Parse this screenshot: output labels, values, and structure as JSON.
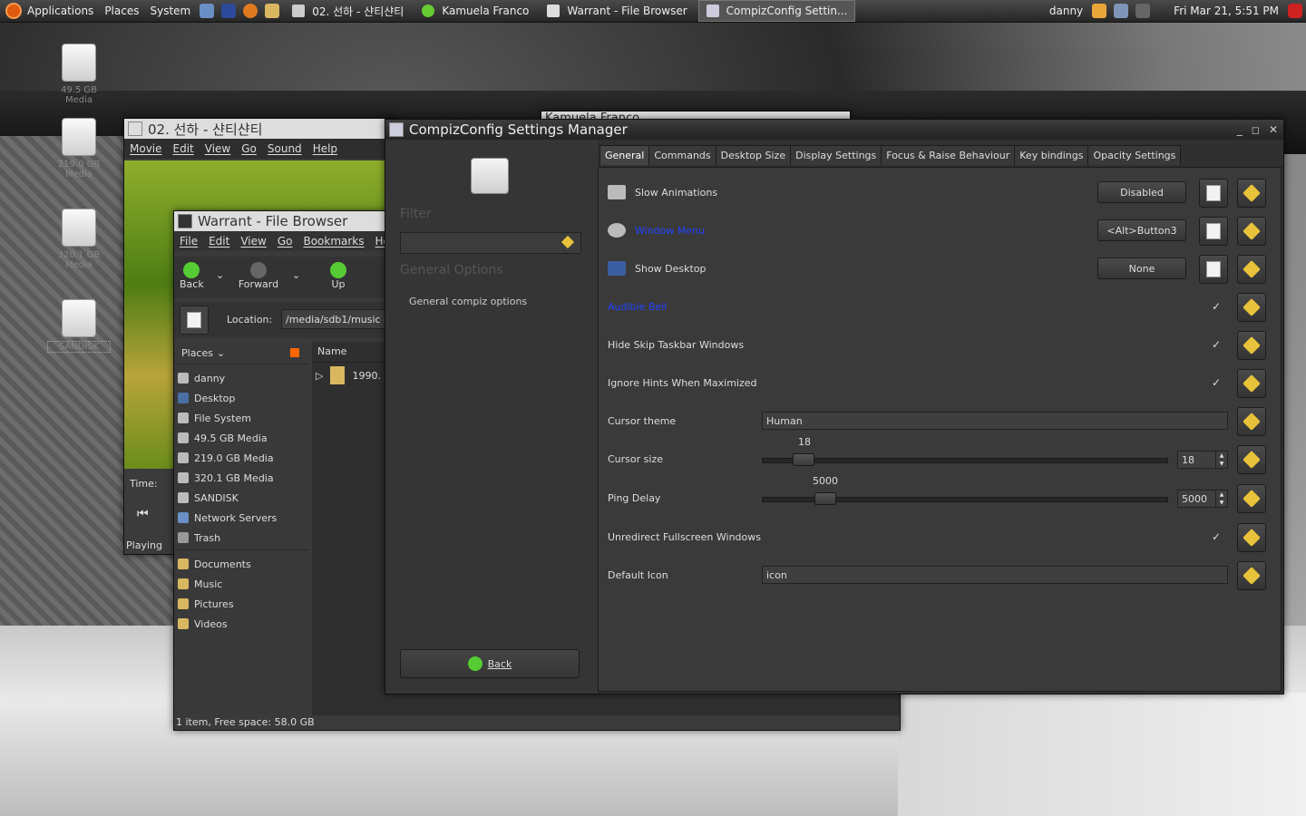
{
  "top_panel": {
    "menus": [
      "Applications",
      "Places",
      "System"
    ],
    "tasks": [
      "02. 선하 - 샨티샨티",
      "Kamuela Franco",
      "Warrant - File Browser",
      "CompizConfig Settin..."
    ],
    "user": "danny",
    "datetime": "Fri Mar 21,  5:51 PM"
  },
  "desktop": {
    "icons": [
      {
        "label": "49.5 GB Media"
      },
      {
        "label": "219.0 GB Media"
      },
      {
        "label": "320.1 GB Media"
      },
      {
        "label": "SANDISK"
      }
    ]
  },
  "movie_player": {
    "title": "02. 선하 - 샨티샨티",
    "menu": [
      "Movie",
      "Edit",
      "View",
      "Go",
      "Sound",
      "Help"
    ],
    "time_label": "Time:",
    "status": "Playing"
  },
  "background_window": {
    "title": "Kamuela Franco"
  },
  "file_browser": {
    "title": "Warrant - File Browser",
    "menu": [
      "File",
      "Edit",
      "View",
      "Go",
      "Bookmarks",
      "Help"
    ],
    "toolbar": {
      "back": "Back",
      "forward": "Forward",
      "up": "Up"
    },
    "location_label": "Location:",
    "location": "/media/sdb1/music",
    "places_label": "Places",
    "places": [
      {
        "label": "danny",
        "icon": "home-icon"
      },
      {
        "label": "Desktop",
        "icon": "desktop-icon"
      },
      {
        "label": "File System",
        "icon": "drive-icon"
      },
      {
        "label": "49.5 GB Media",
        "icon": "drive-icon"
      },
      {
        "label": "219.0 GB Media",
        "icon": "drive-icon"
      },
      {
        "label": "320.1 GB Media",
        "icon": "drive-icon"
      },
      {
        "label": "SANDISK",
        "icon": "drive-icon"
      },
      {
        "label": "Network Servers",
        "icon": "network-icon"
      },
      {
        "label": "Trash",
        "icon": "trash-icon"
      }
    ],
    "bookmarks": [
      "Documents",
      "Music",
      "Pictures",
      "Videos"
    ],
    "column_name": "Name",
    "files": [
      "1990."
    ],
    "status": "1 item, Free space: 58.0 GB"
  },
  "compiz": {
    "title": "CompizConfig Settings Manager",
    "filter_label": "Filter",
    "filter_value": "",
    "section_title": "General Options",
    "section_item": "General compiz options",
    "back_label": "Back",
    "tabs": [
      "General",
      "Commands",
      "Desktop Size",
      "Display Settings",
      "Focus & Raise Behaviour",
      "Key bindings",
      "Opacity Settings"
    ],
    "rows": {
      "slow_animations": {
        "label": "Slow Animations",
        "value": "Disabled"
      },
      "window_menu": {
        "label": "Window Menu",
        "value": "<Alt>Button3"
      },
      "show_desktop": {
        "label": "Show Desktop",
        "value": "None"
      },
      "audible_bell": {
        "label": "Audible Bell",
        "checked": true
      },
      "hide_skip_taskbar": {
        "label": "Hide Skip Taskbar Windows",
        "checked": true
      },
      "ignore_hints": {
        "label": "Ignore Hints When Maximized",
        "checked": true
      },
      "cursor_theme": {
        "label": "Cursor theme",
        "value": "Human"
      },
      "cursor_size": {
        "label": "Cursor size",
        "value": "18",
        "slider_value": "18"
      },
      "ping_delay": {
        "label": "Ping Delay",
        "value": "5000",
        "slider_value": "5000"
      },
      "unredirect": {
        "label": "Unredirect Fullscreen Windows",
        "checked": true
      },
      "default_icon": {
        "label": "Default Icon",
        "value": "icon"
      }
    },
    "checkmark": "✓"
  }
}
